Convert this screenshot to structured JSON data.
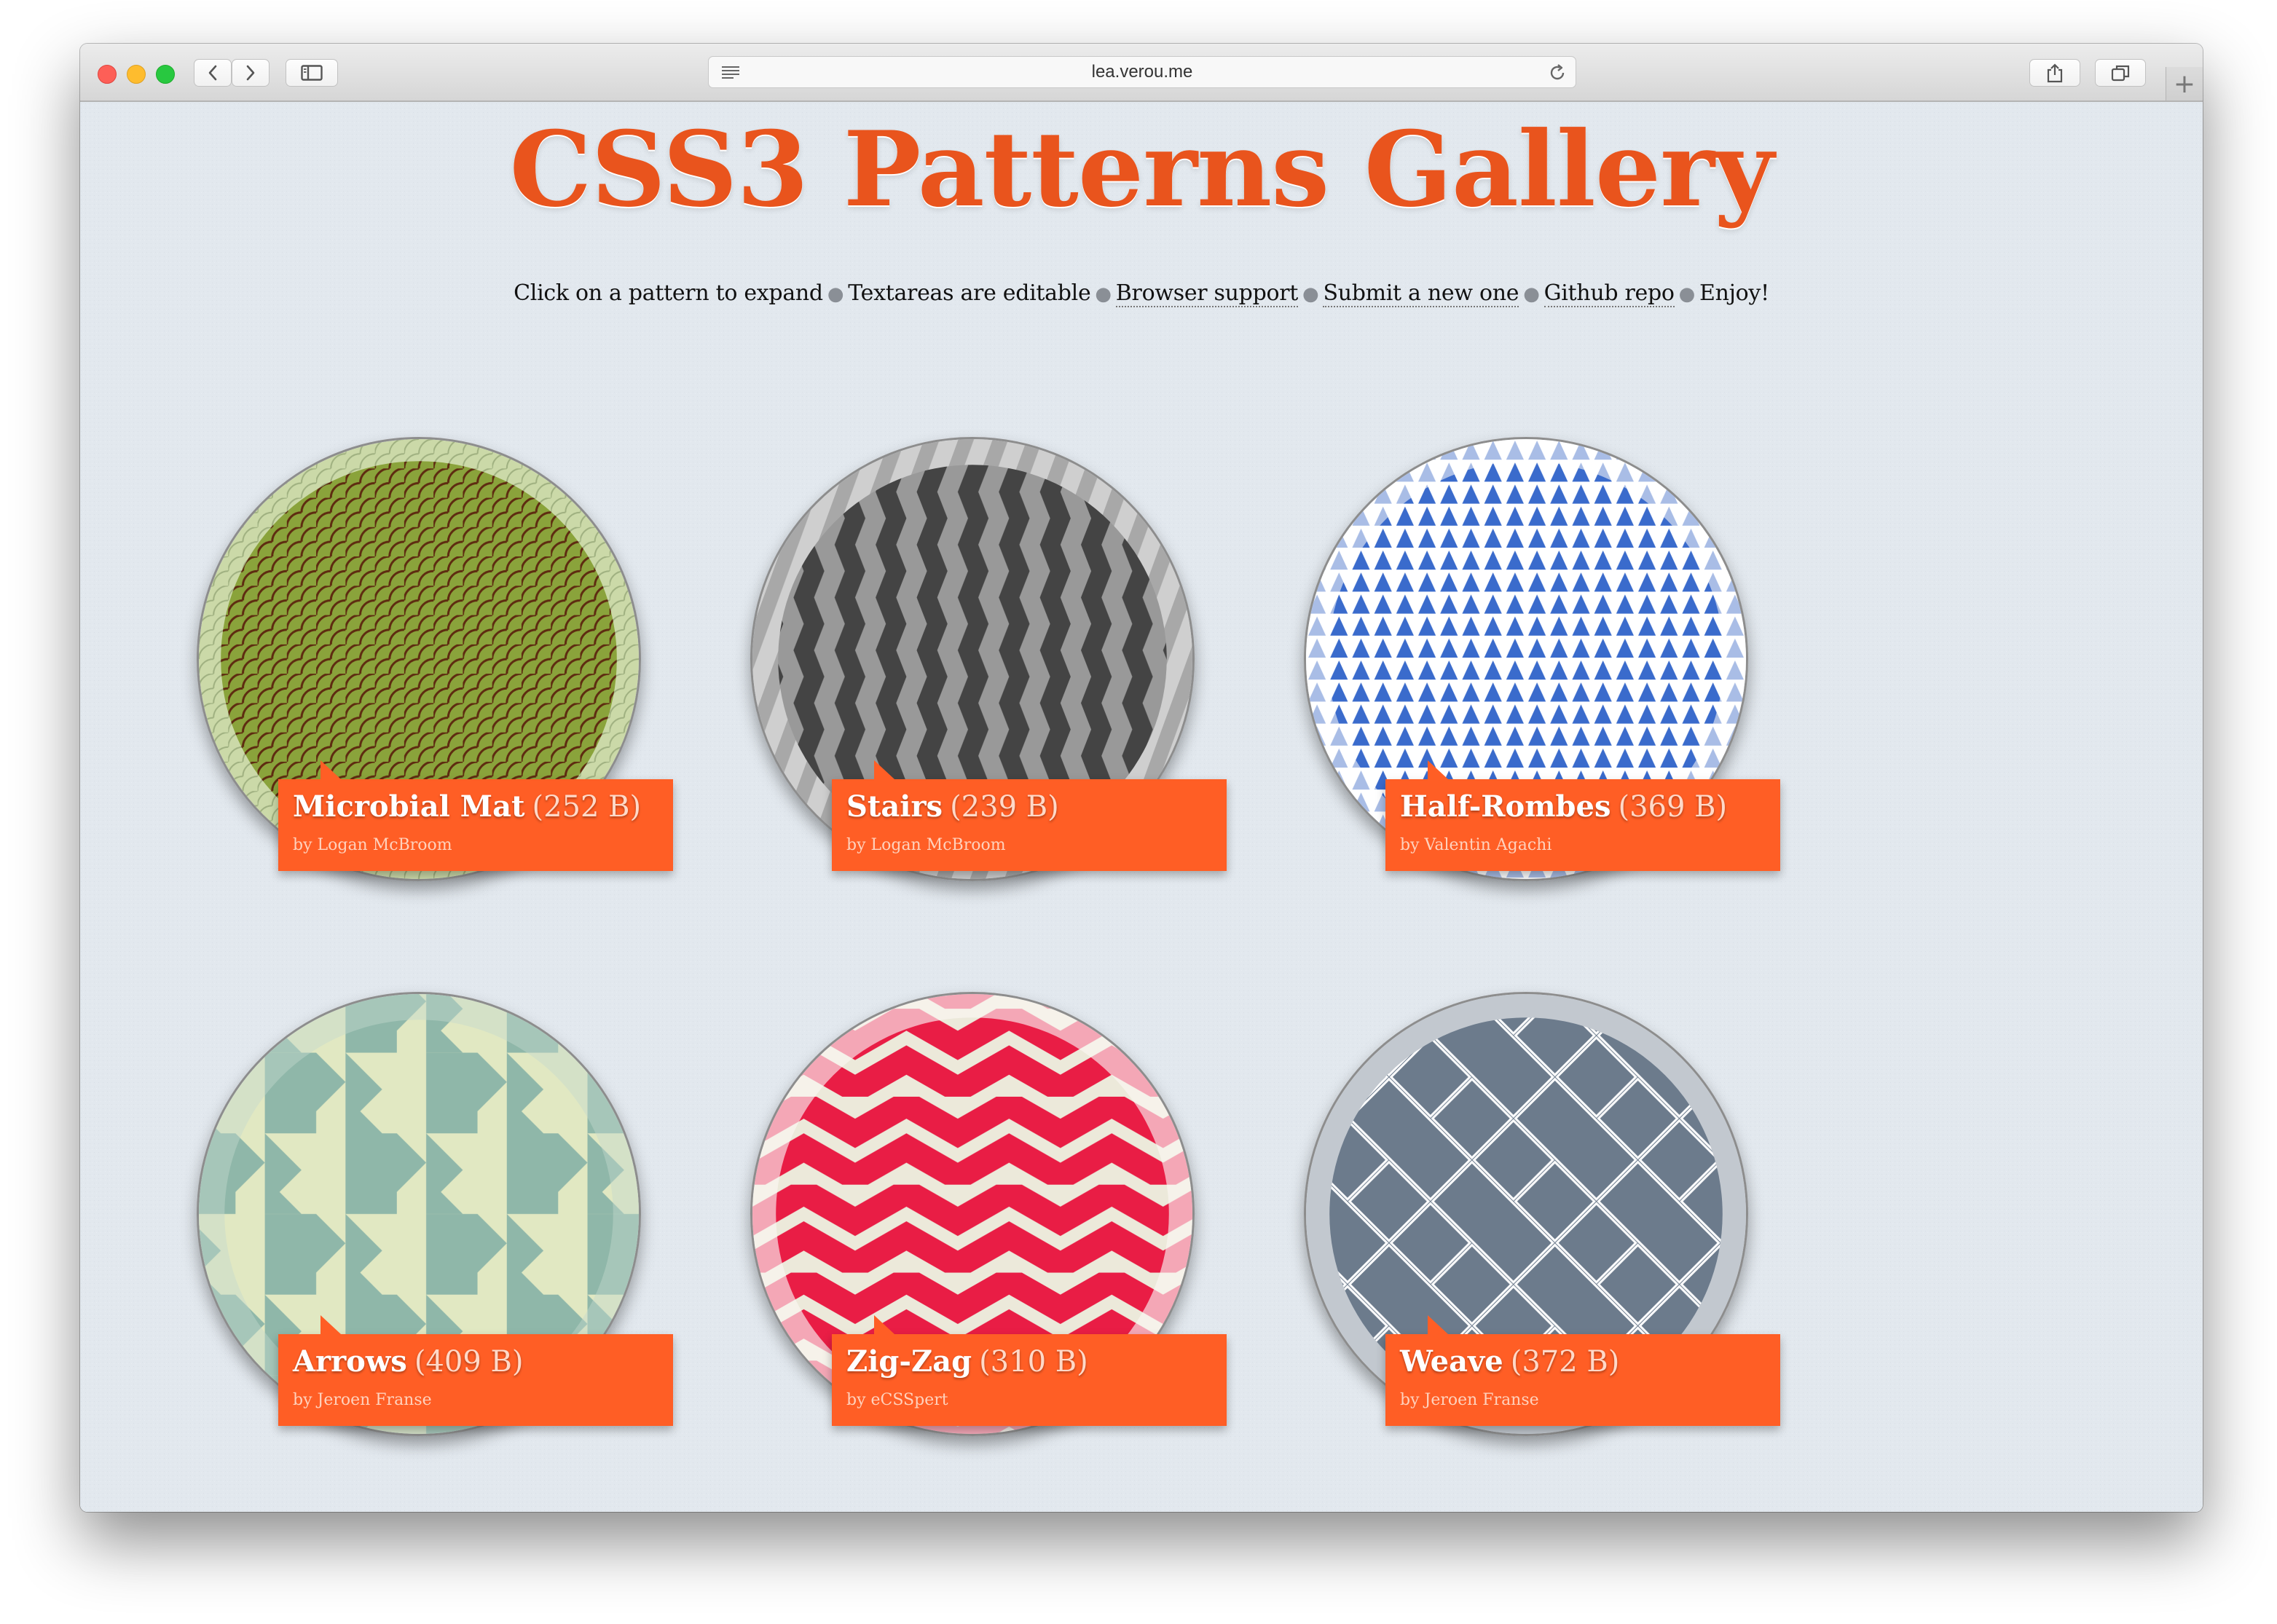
{
  "browser": {
    "url": "lea.verou.me",
    "tab_add_label": "+"
  },
  "page": {
    "title": "CSS3 Patterns Gallery",
    "nav": {
      "click_text": "Click on a pattern to expand",
      "textarea_text": "Textareas are editable",
      "browser_support": "Browser support",
      "submit": "Submit a new one",
      "github": "Github repo",
      "enjoy": "Enjoy!"
    }
  },
  "patterns": [
    {
      "name": "Microbial Mat",
      "size": "(252 B)",
      "author": "by Logan McBroom",
      "colors": [
        "#8aa33b",
        "#5e2b10",
        "#cbd9a8"
      ]
    },
    {
      "name": "Stairs",
      "size": "(239 B)",
      "author": "by Logan McBroom",
      "colors": [
        "#444444",
        "#999999",
        "#c8c8c8"
      ]
    },
    {
      "name": "Half-Rombes",
      "size": "(369 B)",
      "author": "by Valentin Agachi",
      "colors": [
        "#3a6bcc",
        "#ffffff",
        "#a9bde6"
      ]
    },
    {
      "name": "Arrows",
      "size": "(409 B)",
      "author": "by Jeroen Franse",
      "colors": [
        "#8fb7a9",
        "#e1e8c2",
        "#c3d8cc"
      ]
    },
    {
      "name": "Zig-Zag",
      "size": "(310 B)",
      "author": "by eCSSpert",
      "colors": [
        "#e91d45",
        "#ece9da",
        "#f4a7b6"
      ]
    },
    {
      "name": "Weave",
      "size": "(372 B)",
      "author": "by Jeroen Franse",
      "colors": [
        "#6c7b8c",
        "#ffffff",
        "#c2c8cf"
      ]
    }
  ]
}
